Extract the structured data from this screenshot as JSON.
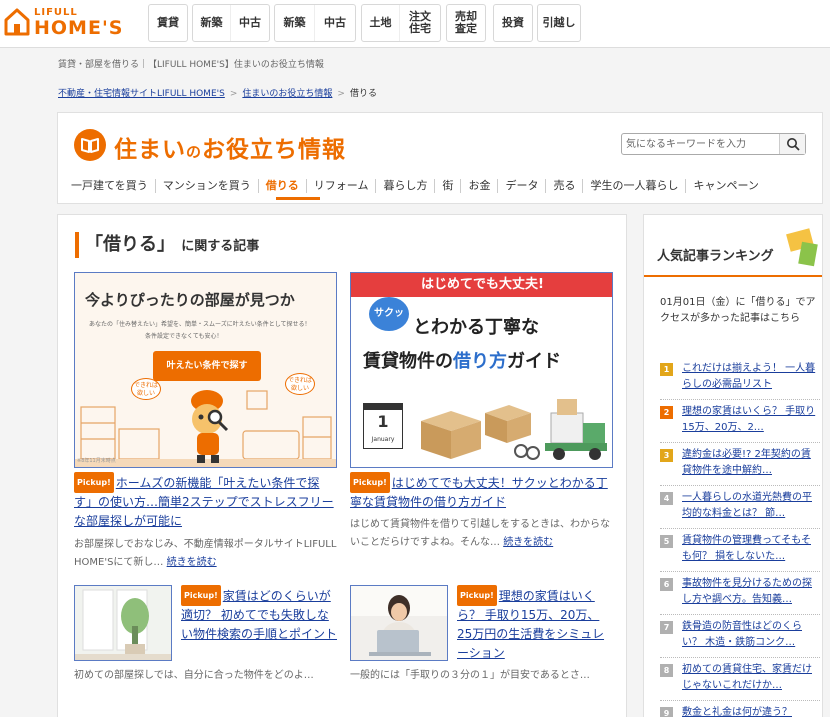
{
  "header": {
    "logo_top": "LIFULL",
    "logo_bottom": "HOME'S",
    "nav": [
      {
        "items": [
          "賃貸"
        ]
      },
      {
        "items": [
          "新築",
          "中古"
        ]
      },
      {
        "items": [
          "新築",
          "中古"
        ]
      },
      {
        "items": [
          "土地",
          "注文\n住宅"
        ]
      },
      {
        "items": [
          "売却\n査定"
        ]
      },
      {
        "items": [
          "投資"
        ]
      },
      {
        "items": [
          "引越し"
        ]
      }
    ]
  },
  "page_subtitle": "賃貸・部屋を借りる｜【LIFULL HOME'S】住まいのお役立ち情報",
  "breadcrumb": [
    "不動産・住宅情報サイトLIFULL HOME'S",
    "住まいのお役立ち情報",
    "借りる"
  ],
  "site": {
    "title_a": "住まい",
    "title_no": "の",
    "title_b": "お役立ち情報",
    "search_placeholder": "気になるキーワードを入力",
    "categories": [
      "一戸建てを買う",
      "マンションを買う",
      "借りる",
      "リフォーム",
      "暮らし方",
      "街",
      "お金",
      "データ",
      "売る",
      "学生の一人暮らし",
      "キャンペーン"
    ]
  },
  "section": {
    "title_main": "「借りる」",
    "title_sub": "に関する記事"
  },
  "articles": [
    {
      "pick": "Pickup!",
      "title": "ホームズの新機能「叶えたい条件で探す」の使い方…簡単2ステップでストレスフリーな部屋探しが可能に",
      "desc": "お部屋探しでおなじみ、不動産情報ポータルサイトLIFULL HOME'Sにて新し…",
      "more": "続きを読む",
      "img_heading": "今よりぴったりの部屋が見つか",
      "img_text1": "あなたの「住み替えたい」希望を、簡単・スムーズに叶えたい条件として探せる！",
      "img_text2": "条件設定できなくても安心！",
      "img_button": "叶えたい条件で探す",
      "img_bubble_l": "できれば\n欲しい",
      "img_bubble_r": "できれば\n欲しい",
      "img_note": "※8年11月末時点"
    },
    {
      "pick": "Pickup!",
      "title": "はじめてでも大丈夫！サクッとわかる丁寧な賃貸物件の借り方ガイド",
      "desc": "はじめて賃貸物件を借りて引越しをするときは、わからないことだらけですよね。そんな…",
      "more": "続きを読む",
      "img_banner": "はじめてでも大丈夫!",
      "img_bubble": "サクッ",
      "img_line1": "とわかる丁寧な",
      "img_line2a": "賃貸物件の",
      "img_line2b": "借り方",
      "img_line2c": "ガイド",
      "img_cal_num": "1",
      "img_cal_month": "January"
    },
    {
      "pick": "Pickup!",
      "title": "家賃はどのくらいが適切？ 初めてでも失敗しない物件検索の手順とポイント",
      "desc": "初めての部屋探しでは、自分に合った物件をどのよ…"
    },
    {
      "pick": "Pickup!",
      "title": "理想の家賃はいくら？ 手取り15万、20万、25万円の生活費をシミュレーション",
      "desc": "一般的には「手取りの３分の１」が目安であるとさ…"
    }
  ],
  "sidebar": {
    "title": "人気記事ランキング",
    "note": "01月01日（金）に「借りる」でアクセスが多かった記事はこちら",
    "rankings": [
      {
        "num": "1",
        "title": "これだけは揃えよう！ 一人暮らしの必需品リスト"
      },
      {
        "num": "2",
        "title": "理想の家賃はいくら？ 手取り15万、20万、2…"
      },
      {
        "num": "3",
        "title": "違約金は必要!? 2年契約の賃貸物件を途中解約…"
      },
      {
        "num": "4",
        "title": "一人暮らしの水道光熱費の平均的な料金とは？ 節…"
      },
      {
        "num": "5",
        "title": "賃貸物件の管理費ってそもそも何？ 損をしないた…"
      },
      {
        "num": "6",
        "title": "事故物件を見分けるための探し方や調べ方。告知義…"
      },
      {
        "num": "7",
        "title": "鉄骨造の防音性はどのくらい？ 木造・鉄筋コンク…"
      },
      {
        "num": "8",
        "title": "初めての賃貸住宅、家賃だけじゃないこれだけか…"
      },
      {
        "num": "9",
        "title": "敷金と礼金は何が違う？"
      }
    ]
  }
}
